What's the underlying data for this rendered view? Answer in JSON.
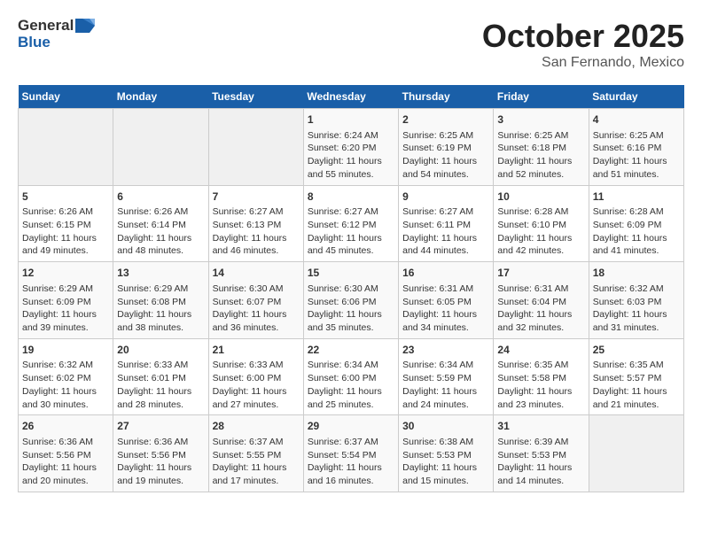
{
  "header": {
    "logo_general": "General",
    "logo_blue": "Blue",
    "month": "October 2025",
    "location": "San Fernando, Mexico"
  },
  "weekdays": [
    "Sunday",
    "Monday",
    "Tuesday",
    "Wednesday",
    "Thursday",
    "Friday",
    "Saturday"
  ],
  "weeks": [
    [
      {
        "day": "",
        "info": ""
      },
      {
        "day": "",
        "info": ""
      },
      {
        "day": "",
        "info": ""
      },
      {
        "day": "1",
        "info": "Sunrise: 6:24 AM\nSunset: 6:20 PM\nDaylight: 11 hours\nand 55 minutes."
      },
      {
        "day": "2",
        "info": "Sunrise: 6:25 AM\nSunset: 6:19 PM\nDaylight: 11 hours\nand 54 minutes."
      },
      {
        "day": "3",
        "info": "Sunrise: 6:25 AM\nSunset: 6:18 PM\nDaylight: 11 hours\nand 52 minutes."
      },
      {
        "day": "4",
        "info": "Sunrise: 6:25 AM\nSunset: 6:16 PM\nDaylight: 11 hours\nand 51 minutes."
      }
    ],
    [
      {
        "day": "5",
        "info": "Sunrise: 6:26 AM\nSunset: 6:15 PM\nDaylight: 11 hours\nand 49 minutes."
      },
      {
        "day": "6",
        "info": "Sunrise: 6:26 AM\nSunset: 6:14 PM\nDaylight: 11 hours\nand 48 minutes."
      },
      {
        "day": "7",
        "info": "Sunrise: 6:27 AM\nSunset: 6:13 PM\nDaylight: 11 hours\nand 46 minutes."
      },
      {
        "day": "8",
        "info": "Sunrise: 6:27 AM\nSunset: 6:12 PM\nDaylight: 11 hours\nand 45 minutes."
      },
      {
        "day": "9",
        "info": "Sunrise: 6:27 AM\nSunset: 6:11 PM\nDaylight: 11 hours\nand 44 minutes."
      },
      {
        "day": "10",
        "info": "Sunrise: 6:28 AM\nSunset: 6:10 PM\nDaylight: 11 hours\nand 42 minutes."
      },
      {
        "day": "11",
        "info": "Sunrise: 6:28 AM\nSunset: 6:09 PM\nDaylight: 11 hours\nand 41 minutes."
      }
    ],
    [
      {
        "day": "12",
        "info": "Sunrise: 6:29 AM\nSunset: 6:09 PM\nDaylight: 11 hours\nand 39 minutes."
      },
      {
        "day": "13",
        "info": "Sunrise: 6:29 AM\nSunset: 6:08 PM\nDaylight: 11 hours\nand 38 minutes."
      },
      {
        "day": "14",
        "info": "Sunrise: 6:30 AM\nSunset: 6:07 PM\nDaylight: 11 hours\nand 36 minutes."
      },
      {
        "day": "15",
        "info": "Sunrise: 6:30 AM\nSunset: 6:06 PM\nDaylight: 11 hours\nand 35 minutes."
      },
      {
        "day": "16",
        "info": "Sunrise: 6:31 AM\nSunset: 6:05 PM\nDaylight: 11 hours\nand 34 minutes."
      },
      {
        "day": "17",
        "info": "Sunrise: 6:31 AM\nSunset: 6:04 PM\nDaylight: 11 hours\nand 32 minutes."
      },
      {
        "day": "18",
        "info": "Sunrise: 6:32 AM\nSunset: 6:03 PM\nDaylight: 11 hours\nand 31 minutes."
      }
    ],
    [
      {
        "day": "19",
        "info": "Sunrise: 6:32 AM\nSunset: 6:02 PM\nDaylight: 11 hours\nand 30 minutes."
      },
      {
        "day": "20",
        "info": "Sunrise: 6:33 AM\nSunset: 6:01 PM\nDaylight: 11 hours\nand 28 minutes."
      },
      {
        "day": "21",
        "info": "Sunrise: 6:33 AM\nSunset: 6:00 PM\nDaylight: 11 hours\nand 27 minutes."
      },
      {
        "day": "22",
        "info": "Sunrise: 6:34 AM\nSunset: 6:00 PM\nDaylight: 11 hours\nand 25 minutes."
      },
      {
        "day": "23",
        "info": "Sunrise: 6:34 AM\nSunset: 5:59 PM\nDaylight: 11 hours\nand 24 minutes."
      },
      {
        "day": "24",
        "info": "Sunrise: 6:35 AM\nSunset: 5:58 PM\nDaylight: 11 hours\nand 23 minutes."
      },
      {
        "day": "25",
        "info": "Sunrise: 6:35 AM\nSunset: 5:57 PM\nDaylight: 11 hours\nand 21 minutes."
      }
    ],
    [
      {
        "day": "26",
        "info": "Sunrise: 6:36 AM\nSunset: 5:56 PM\nDaylight: 11 hours\nand 20 minutes."
      },
      {
        "day": "27",
        "info": "Sunrise: 6:36 AM\nSunset: 5:56 PM\nDaylight: 11 hours\nand 19 minutes."
      },
      {
        "day": "28",
        "info": "Sunrise: 6:37 AM\nSunset: 5:55 PM\nDaylight: 11 hours\nand 17 minutes."
      },
      {
        "day": "29",
        "info": "Sunrise: 6:37 AM\nSunset: 5:54 PM\nDaylight: 11 hours\nand 16 minutes."
      },
      {
        "day": "30",
        "info": "Sunrise: 6:38 AM\nSunset: 5:53 PM\nDaylight: 11 hours\nand 15 minutes."
      },
      {
        "day": "31",
        "info": "Sunrise: 6:39 AM\nSunset: 5:53 PM\nDaylight: 11 hours\nand 14 minutes."
      },
      {
        "day": "",
        "info": ""
      }
    ]
  ]
}
